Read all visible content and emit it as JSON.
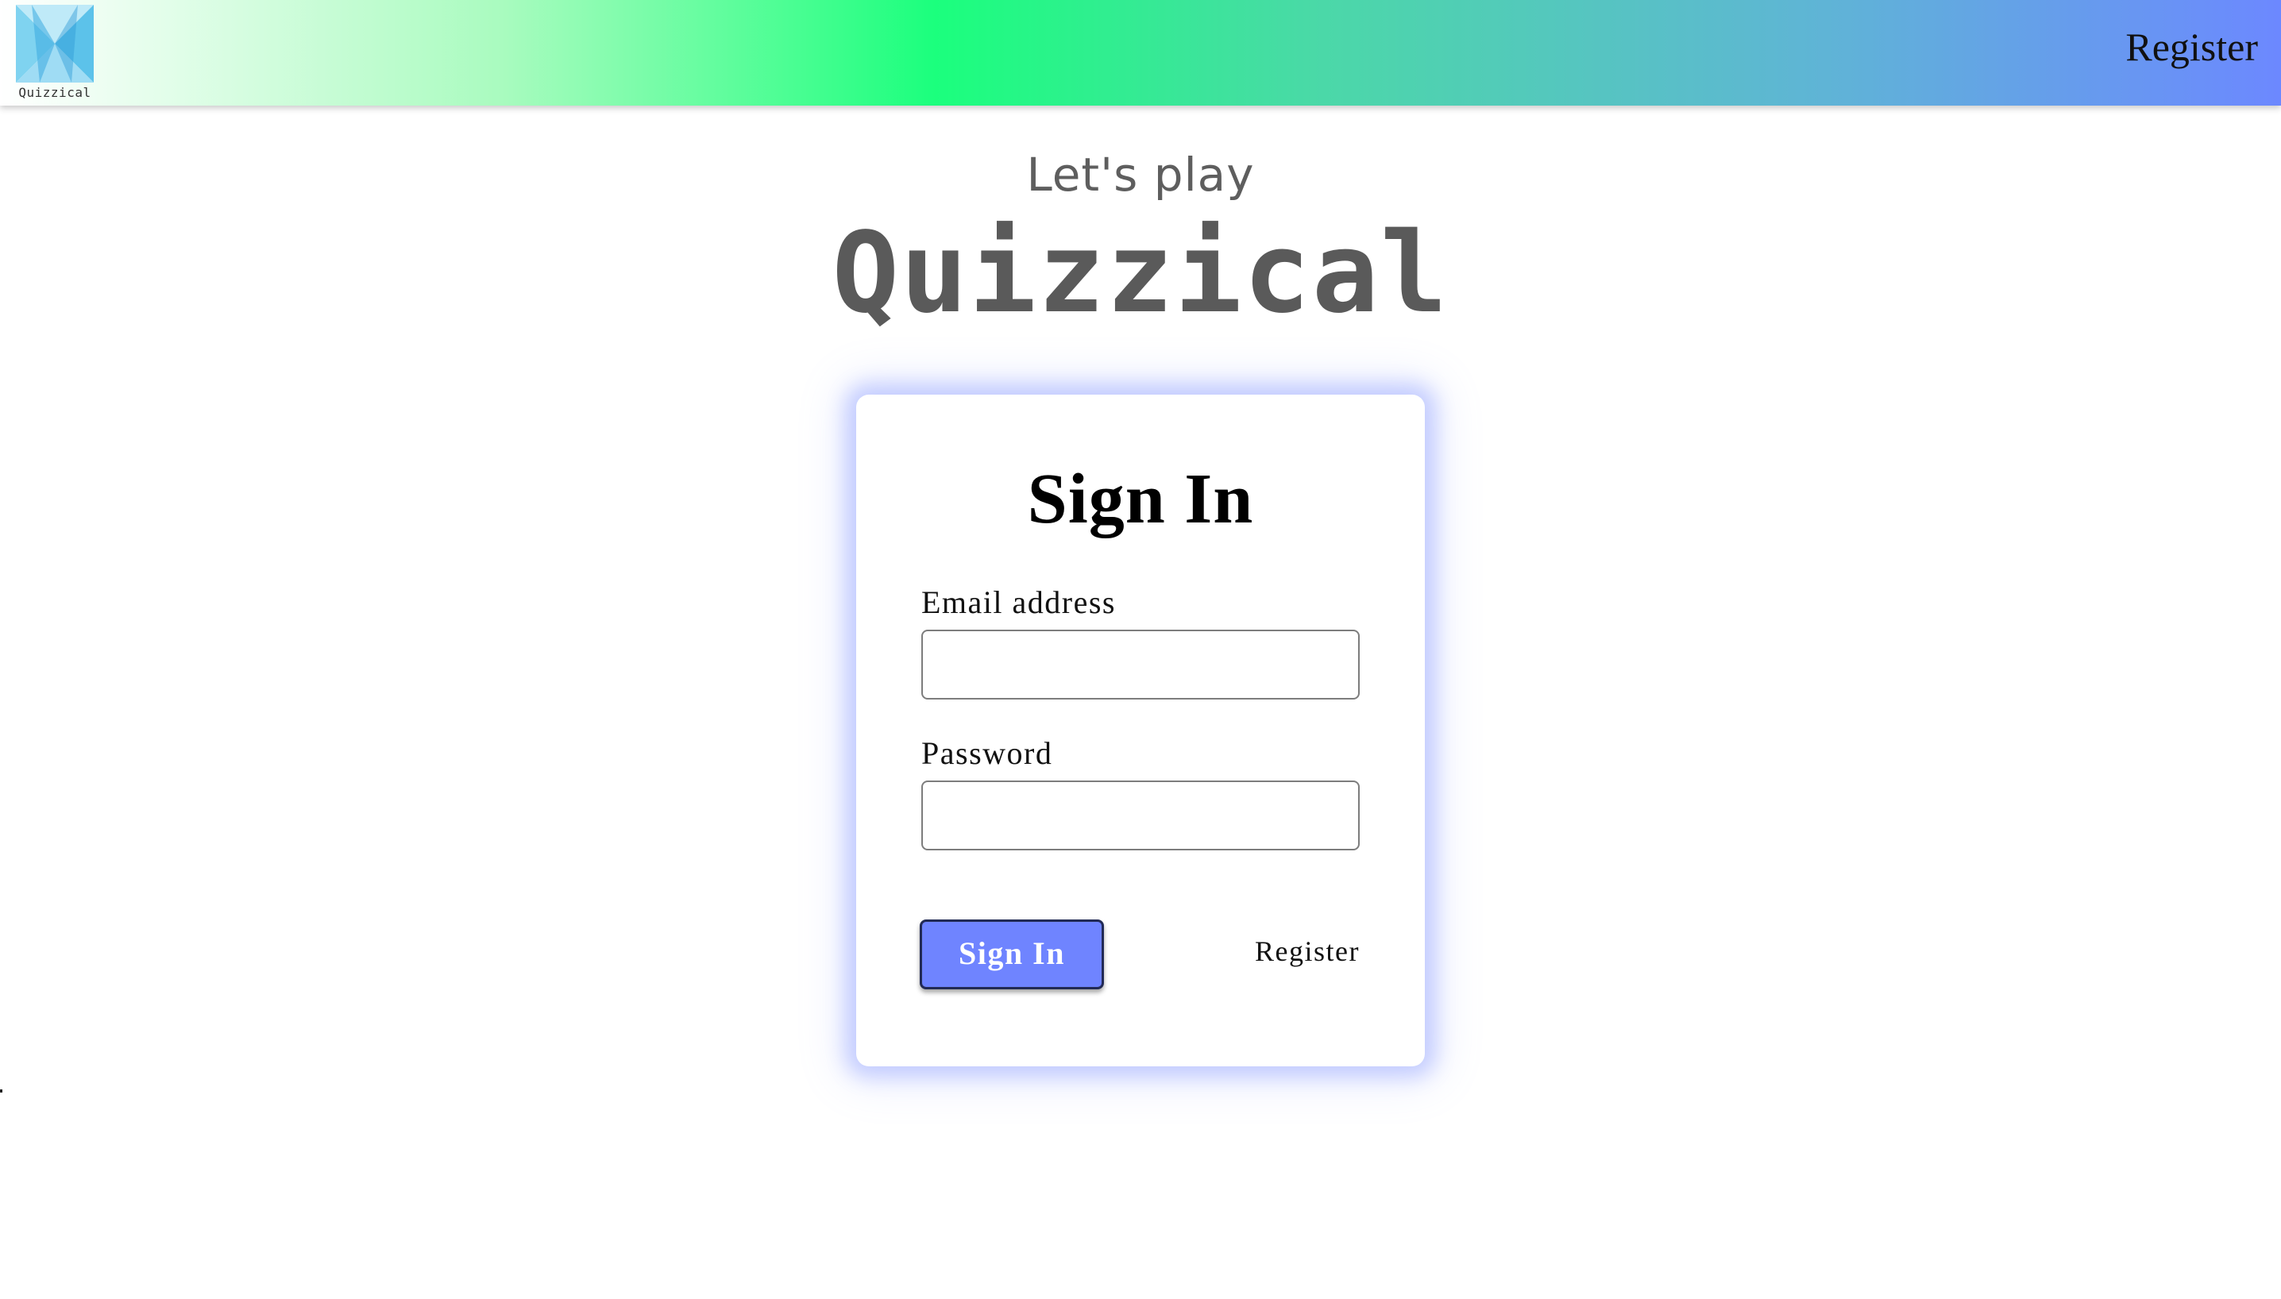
{
  "header": {
    "logo_text": "Quizzical",
    "register_link": "Register",
    "logo_icon": "quizzical-logo-icon"
  },
  "hero": {
    "subtitle": "Let's play",
    "title": "Quizzical"
  },
  "signin_form": {
    "title": "Sign In",
    "email_label": "Email address",
    "email_value": "",
    "password_label": "Password",
    "password_value": "",
    "submit_label": "Sign In",
    "register_link": "Register"
  },
  "colors": {
    "accent": "#6f84ff",
    "title_gray": "#5a5a5a",
    "card_glow": "#6e84ff"
  }
}
